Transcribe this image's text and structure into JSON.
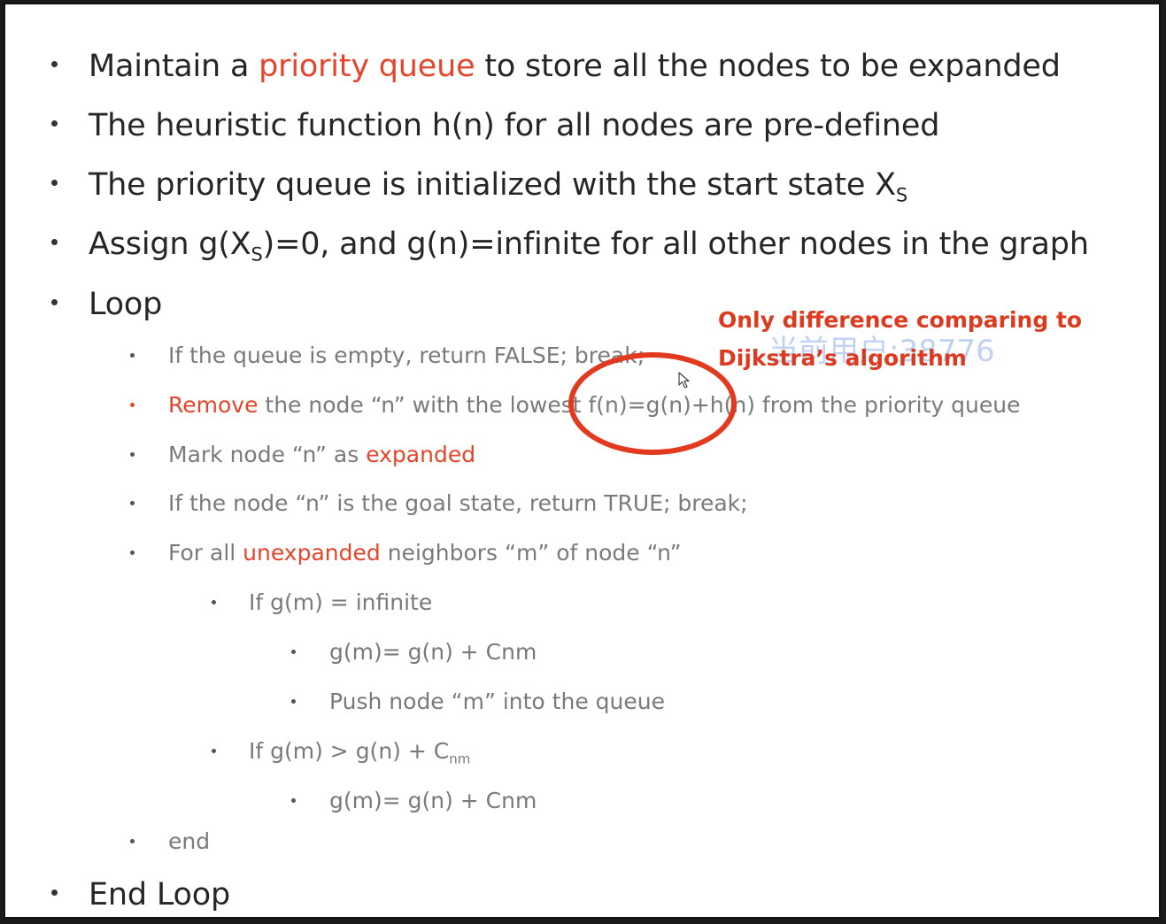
{
  "main_points": [
    {
      "before": "Maintain a ",
      "highlight": "priority queue",
      "after": " to store all the nodes to be expanded"
    },
    {
      "text": "The heuristic function h(n) for all nodes are pre-defined"
    },
    {
      "text": "The priority queue is initialized with the start state X",
      "sub": "S"
    },
    {
      "before": "Assign g(X",
      "sub": "S",
      "after": ")=0, and g(n)=infinite for all other nodes in the graph"
    },
    {
      "text": "Loop"
    },
    {
      "text": "End Loop"
    }
  ],
  "loop_steps": {
    "empty_check": "If the queue is empty, return FALSE; break;",
    "remove": {
      "highlight": "Remove",
      "middle": " the node “n” with the lowest ",
      "formula": "f(n)=g(n)+h(n)",
      "after": " from the priority queue"
    },
    "mark": {
      "before": "Mark node “n” as ",
      "highlight": "expanded"
    },
    "goal_check": "If the node “n” is the goal state, return TRUE; break;",
    "neighbors": {
      "before": "For all ",
      "highlight": "unexpanded",
      "after": " neighbors “m” of node “n”"
    },
    "if_infinite": "If g(m) = infinite",
    "assign_1": "g(m)= g(n) + Cnm",
    "push": "Push node “m” into the queue",
    "if_greater": {
      "before": "If g(m) > g(n) + C",
      "sub": "nm"
    },
    "assign_2": "g(m)= g(n) + Cnm",
    "end": "end"
  },
  "annotation": {
    "line1": "Only difference comparing to",
    "line2": "Dijkstra’s algorithm"
  },
  "watermark": "当前用户:38776",
  "colors": {
    "highlight": "#e5452a",
    "annotation": "#dc3b1f",
    "circle": "#e23a1e",
    "main_text": "#262626",
    "sub_text": "#7a7a7a"
  },
  "icons": {
    "cursor": "mouse-pointer-icon"
  }
}
